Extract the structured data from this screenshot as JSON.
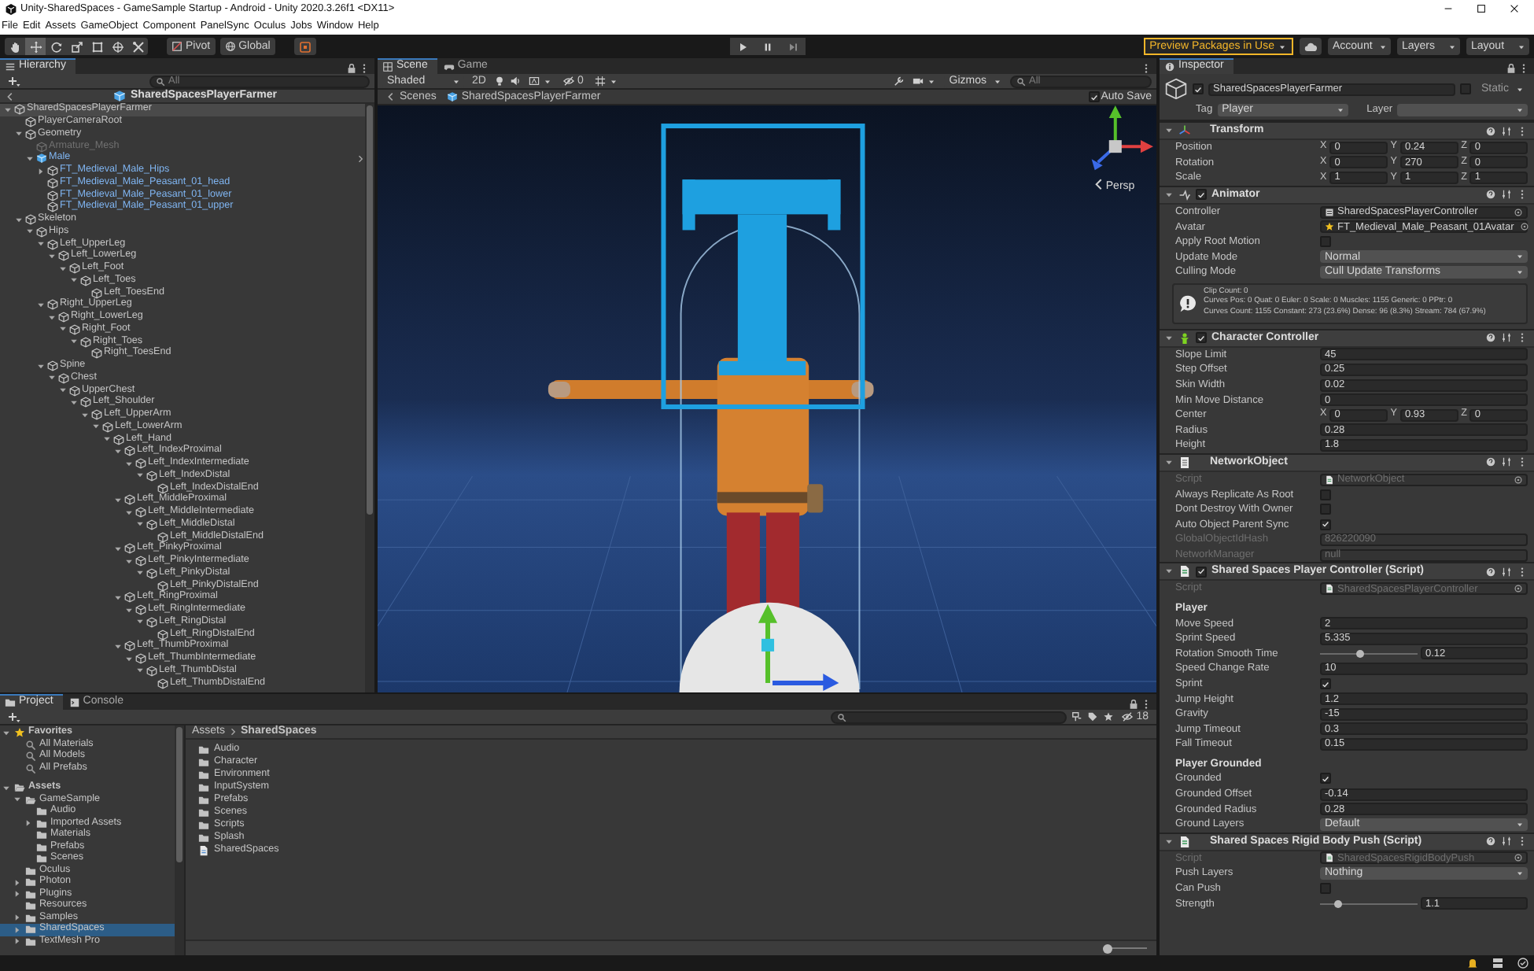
{
  "window": {
    "title": "Unity-SharedSpaces - GameSample Startup - Android - Unity 2020.3.26f1 <DX11>"
  },
  "menu": [
    "File",
    "Edit",
    "Assets",
    "GameObject",
    "Component",
    "PanelSync",
    "Oculus",
    "Jobs",
    "Window",
    "Help"
  ],
  "toolbar": {
    "tools": [
      {
        "kind": "hand",
        "selected": false
      },
      {
        "kind": "move",
        "selected": true
      },
      {
        "kind": "rotate",
        "selected": false
      },
      {
        "kind": "scale",
        "selected": false
      },
      {
        "kind": "rect",
        "selected": false
      },
      {
        "kind": "transform",
        "selected": false
      },
      {
        "kind": "custom",
        "selected": false
      }
    ],
    "pivot": "Pivot",
    "space": "Global",
    "preview_packages": "Preview Packages in Use",
    "account": "Account",
    "layers": "Layers",
    "layout": "Layout"
  },
  "hierarchy": {
    "tab": "Hierarchy",
    "search": {
      "placeholder": "All"
    },
    "prefab_stage": "SharedSpacesPlayerFarmer",
    "items": [
      {
        "name": "SharedSpacesPlayerFarmer",
        "kind": "object",
        "selected": true,
        "expanded": true,
        "children": [
          {
            "name": "PlayerCameraRoot",
            "kind": "object",
            "selected": false
          },
          {
            "name": "Geometry",
            "kind": "object",
            "selected": false,
            "expanded": true,
            "children": [
              {
                "name": "Armature_Mesh",
                "kind": "inactive",
                "selected": false
              },
              {
                "name": "Male",
                "kind": "prefab",
                "selected": false,
                "expanded": true,
                "children": [
                  {
                    "name": "FT_Medieval_Male_Hips",
                    "kind": "prefab_child",
                    "selected": false,
                    "expanded": false
                  },
                  {
                    "name": "FT_Medieval_Male_Peasant_01_head",
                    "kind": "prefab_child",
                    "selected": false
                  },
                  {
                    "name": "FT_Medieval_Male_Peasant_01_lower",
                    "kind": "prefab_child",
                    "selected": false
                  },
                  {
                    "name": "FT_Medieval_Male_Peasant_01_upper",
                    "kind": "prefab_child",
                    "selected": false
                  }
                ]
              }
            ]
          },
          {
            "name": "Skeleton",
            "kind": "object",
            "selected": false,
            "expanded": true,
            "children": [
              {
                "name": "Hips",
                "kind": "object",
                "selected": false,
                "expanded": true,
                "children": [
                  {
                    "name": "Left_UpperLeg",
                    "kind": "object",
                    "selected": false,
                    "expanded": true,
                    "children": [
                      {
                        "name": "Left_LowerLeg",
                        "kind": "object",
                        "selected": false,
                        "expanded": true,
                        "children": [
                          {
                            "name": "Left_Foot",
                            "kind": "object",
                            "selected": false,
                            "expanded": true,
                            "children": [
                              {
                                "name": "Left_Toes",
                                "kind": "object",
                                "selected": false,
                                "expanded": true,
                                "children": [
                                  {
                                    "name": "Left_ToesEnd",
                                    "kind": "object",
                                    "selected": false
                                  }
                                ]
                              }
                            ]
                          }
                        ]
                      }
                    ]
                  },
                  {
                    "name": "Right_UpperLeg",
                    "kind": "object",
                    "selected": false,
                    "expanded": true,
                    "children": [
                      {
                        "name": "Right_LowerLeg",
                        "kind": "object",
                        "selected": false,
                        "expanded": true,
                        "children": [
                          {
                            "name": "Right_Foot",
                            "kind": "object",
                            "selected": false,
                            "expanded": true,
                            "children": [
                              {
                                "name": "Right_Toes",
                                "kind": "object",
                                "selected": false,
                                "expanded": true,
                                "children": [
                                  {
                                    "name": "Right_ToesEnd",
                                    "kind": "object",
                                    "selected": false
                                  }
                                ]
                              }
                            ]
                          }
                        ]
                      }
                    ]
                  },
                  {
                    "name": "Spine",
                    "kind": "object",
                    "selected": false,
                    "expanded": true,
                    "children": [
                      {
                        "name": "Chest",
                        "kind": "object",
                        "selected": false,
                        "expanded": true,
                        "children": [
                          {
                            "name": "UpperChest",
                            "kind": "object",
                            "selected": false,
                            "expanded": true,
                            "children": [
                              {
                                "name": "Left_Shoulder",
                                "kind": "object",
                                "selected": false,
                                "expanded": true,
                                "children": [
                                  {
                                    "name": "Left_UpperArm",
                                    "kind": "object",
                                    "selected": false,
                                    "expanded": true,
                                    "children": [
                                      {
                                        "name": "Left_LowerArm",
                                        "kind": "object",
                                        "selected": false,
                                        "expanded": true,
                                        "children": [
                                          {
                                            "name": "Left_Hand",
                                            "kind": "object",
                                            "selected": false,
                                            "expanded": true,
                                            "children": [
                                              {
                                                "name": "Left_IndexProximal",
                                                "kind": "object",
                                                "selected": false,
                                                "expanded": true,
                                                "children": [
                                                  {
                                                    "name": "Left_IndexIntermediate",
                                                    "kind": "object",
                                                    "selected": false,
                                                    "expanded": true,
                                                    "children": [
                                                      {
                                                        "name": "Left_IndexDistal",
                                                        "kind": "object",
                                                        "selected": false,
                                                        "expanded": true,
                                                        "children": [
                                                          {
                                                            "name": "Left_IndexDistalEnd",
                                                            "kind": "object",
                                                            "selected": false
                                                          }
                                                        ]
                                                      }
                                                    ]
                                                  }
                                                ]
                                              },
                                              {
                                                "name": "Left_MiddleProximal",
                                                "kind": "object",
                                                "selected": false,
                                                "expanded": true,
                                                "children": [
                                                  {
                                                    "name": "Left_MiddleIntermediate",
                                                    "kind": "object",
                                                    "selected": false,
                                                    "expanded": true,
                                                    "children": [
                                                      {
                                                        "name": "Left_MiddleDistal",
                                                        "kind": "object",
                                                        "selected": false,
                                                        "expanded": true,
                                                        "children": [
                                                          {
                                                            "name": "Left_MiddleDistalEnd",
                                                            "kind": "object",
                                                            "selected": false
                                                          }
                                                        ]
                                                      }
                                                    ]
                                                  }
                                                ]
                                              },
                                              {
                                                "name": "Left_PinkyProximal",
                                                "kind": "object",
                                                "selected": false,
                                                "expanded": true,
                                                "children": [
                                                  {
                                                    "name": "Left_PinkyIntermediate",
                                                    "kind": "object",
                                                    "selected": false,
                                                    "expanded": true,
                                                    "children": [
                                                      {
                                                        "name": "Left_PinkyDistal",
                                                        "kind": "object",
                                                        "selected": false,
                                                        "expanded": true,
                                                        "children": [
                                                          {
                                                            "name": "Left_PinkyDistalEnd",
                                                            "kind": "object",
                                                            "selected": false
                                                          }
                                                        ]
                                                      }
                                                    ]
                                                  }
                                                ]
                                              },
                                              {
                                                "name": "Left_RingProximal",
                                                "kind": "object",
                                                "selected": false,
                                                "expanded": true,
                                                "children": [
                                                  {
                                                    "name": "Left_RingIntermediate",
                                                    "kind": "object",
                                                    "selected": false,
                                                    "expanded": true,
                                                    "children": [
                                                      {
                                                        "name": "Left_RingDistal",
                                                        "kind": "object",
                                                        "selected": false,
                                                        "expanded": true,
                                                        "children": [
                                                          {
                                                            "name": "Left_RingDistalEnd",
                                                            "kind": "object",
                                                            "selected": false
                                                          }
                                                        ]
                                                      }
                                                    ]
                                                  }
                                                ]
                                              },
                                              {
                                                "name": "Left_ThumbProximal",
                                                "kind": "object",
                                                "selected": false,
                                                "expanded": true,
                                                "children": [
                                                  {
                                                    "name": "Left_ThumbIntermediate",
                                                    "kind": "object",
                                                    "selected": false,
                                                    "expanded": true,
                                                    "children": [
                                                      {
                                                        "name": "Left_ThumbDistal",
                                                        "kind": "object",
                                                        "selected": false,
                                                        "expanded": true,
                                                        "children": [
                                                          {
                                                            "name": "Left_ThumbDistalEnd",
                                                            "kind": "object",
                                                            "selected": false
                                                          }
                                                        ]
                                                      }
                                                    ]
                                                  }
                                                ]
                                              }
                                            ]
                                          }
                                        ]
                                      }
                                    ]
                                  }
                                ]
                              }
                            ]
                          }
                        ]
                      }
                    ]
                  }
                ]
              }
            ]
          }
        ]
      }
    ]
  },
  "scene": {
    "tabs": [
      {
        "label": "Scene",
        "kind": "scene",
        "selected": true
      },
      {
        "label": "Game",
        "kind": "game",
        "selected": false
      }
    ],
    "shading": "Shaded",
    "mode_2d": "2D",
    "hidden_count": "0",
    "gizmos": "Gizmos",
    "search": {
      "placeholder": "All"
    },
    "breadcrumb": [
      "Scenes",
      "SharedSpacesPlayerFarmer"
    ],
    "auto_save": {
      "label": "Auto Save",
      "checked": true
    },
    "view_label": "Persp"
  },
  "inspector": {
    "tab": "Inspector",
    "object": {
      "active": true,
      "name": "SharedSpacesPlayerFarmer",
      "static": false,
      "static_label": "Static",
      "tag_label": "Tag",
      "tag": "Player",
      "layer_label": "Layer"
    },
    "components": [
      {
        "title": "Transform",
        "kind": "transform",
        "rows": [
          {
            "label": "Position",
            "kind": "vector",
            "values": [
              {
                "axis": "X",
                "value": "0"
              },
              {
                "axis": "Y",
                "value": "0.24"
              },
              {
                "axis": "Z",
                "value": "0"
              }
            ]
          },
          {
            "label": "Rotation",
            "kind": "vector",
            "values": [
              {
                "axis": "X",
                "value": "0"
              },
              {
                "axis": "Y",
                "value": "270"
              },
              {
                "axis": "Z",
                "value": "0"
              }
            ]
          },
          {
            "label": "Scale",
            "kind": "vector",
            "values": [
              {
                "axis": "X",
                "value": "1"
              },
              {
                "axis": "Y",
                "value": "1"
              },
              {
                "axis": "Z",
                "value": "1"
              }
            ]
          }
        ]
      },
      {
        "title": "Animator",
        "kind": "animator",
        "enabled": true,
        "rows": [
          {
            "label": "Controller",
            "kind": "object",
            "value": "SharedSpacesPlayerController"
          },
          {
            "label": "Avatar",
            "kind": "object",
            "value": "FT_Medieval_Male_Peasant_01Avatar"
          },
          {
            "label": "Apply Root Motion",
            "kind": "toggle",
            "checked": false
          },
          {
            "label": "Update Mode",
            "kind": "dropdown",
            "value": "Normal"
          },
          {
            "label": "Culling Mode",
            "kind": "dropdown",
            "value": "Cull Update Transforms"
          },
          {
            "kind": "info",
            "lines": [
              "Clip Count: 0",
              "Curves Pos: 0 Quat: 0 Euler: 0 Scale: 0 Muscles: 1155 Generic: 0 PPtr: 0",
              "Curves Count: 1155 Constant: 273 (23.6%) Dense: 96 (8.3%) Stream: 784 (67.9%)"
            ]
          }
        ]
      },
      {
        "title": "Character Controller",
        "kind": "character",
        "enabled": true,
        "rows": [
          {
            "label": "Slope Limit",
            "kind": "field",
            "value": "45"
          },
          {
            "label": "Step Offset",
            "kind": "field",
            "value": "0.25"
          },
          {
            "label": "Skin Width",
            "kind": "field",
            "value": "0.02"
          },
          {
            "label": "Min Move Distance",
            "kind": "field",
            "value": "0"
          },
          {
            "label": "Center",
            "kind": "vector",
            "values": [
              {
                "axis": "X",
                "value": "0"
              },
              {
                "axis": "Y",
                "value": "0.93"
              },
              {
                "axis": "Z",
                "value": "0"
              }
            ]
          },
          {
            "label": "Radius",
            "kind": "field",
            "value": "0.28"
          },
          {
            "label": "Height",
            "kind": "field",
            "value": "1.8"
          }
        ]
      },
      {
        "title": "NetworkObject",
        "kind": "network",
        "rows": [
          {
            "label": "Script",
            "kind": "script",
            "value": "NetworkObject"
          },
          {
            "label": "Always Replicate As Root",
            "kind": "toggle",
            "checked": false
          },
          {
            "label": "Dont Destroy With Owner",
            "kind": "toggle",
            "checked": false
          },
          {
            "label": "Auto Object Parent Sync",
            "kind": "toggle",
            "checked": true
          },
          {
            "label": "GlobalObjectIdHash",
            "kind": "readonly",
            "value": "826220090"
          },
          {
            "label": "NetworkManager",
            "kind": "readonly",
            "value": "null"
          }
        ]
      },
      {
        "title": "Shared Spaces Player Controller (Script)",
        "kind": "script",
        "enabled": true,
        "rows": [
          {
            "label": "Script",
            "kind": "script",
            "value": "SharedSpacesPlayerController"
          },
          {
            "label": "Player",
            "kind": "header"
          },
          {
            "label": "Move Speed",
            "kind": "field",
            "value": "2"
          },
          {
            "label": "Sprint Speed",
            "kind": "field",
            "value": "5.335"
          },
          {
            "label": "Rotation Smooth Time",
            "kind": "slider",
            "level": 0.41,
            "reading": "0.12"
          },
          {
            "label": "Speed Change Rate",
            "kind": "field",
            "value": "10"
          },
          {
            "label": "Sprint",
            "kind": "toggle",
            "checked": true
          },
          {
            "label": "Jump Height",
            "kind": "field",
            "value": "1.2"
          },
          {
            "label": "Gravity",
            "kind": "field",
            "value": "-15"
          },
          {
            "label": "Jump Timeout",
            "kind": "field",
            "value": "0.3"
          },
          {
            "label": "Fall Timeout",
            "kind": "field",
            "value": "0.15"
          },
          {
            "label": "Player Grounded",
            "kind": "header"
          },
          {
            "label": "Grounded",
            "kind": "toggle",
            "checked": true
          },
          {
            "label": "Grounded Offset",
            "kind": "field",
            "value": "-0.14"
          },
          {
            "label": "Grounded Radius",
            "kind": "field",
            "value": "0.28"
          },
          {
            "label": "Ground Layers",
            "kind": "dropdown",
            "value": "Default"
          }
        ]
      },
      {
        "title": "Shared Spaces Rigid Body Push (Script)",
        "kind": "script",
        "rows": [
          {
            "label": "Script",
            "kind": "script",
            "value": "SharedSpacesRigidBodyPush"
          },
          {
            "label": "Push Layers",
            "kind": "dropdown",
            "value": "Nothing"
          },
          {
            "label": "Can Push",
            "kind": "toggle",
            "checked": false
          },
          {
            "label": "Strength",
            "kind": "slider",
            "level": 0.15,
            "reading": "1.1"
          }
        ]
      }
    ]
  },
  "project": {
    "tabs": [
      {
        "label": "Project",
        "kind": "project",
        "selected": true
      },
      {
        "label": "Console",
        "kind": "console",
        "selected": false
      }
    ],
    "visible_count": "18",
    "tree": [
      {
        "name": "Favorites",
        "kind": "favorites",
        "selected": false,
        "expanded": true,
        "children": [
          {
            "name": "All Materials",
            "kind": "search",
            "selected": false
          },
          {
            "name": "All Models",
            "kind": "search",
            "selected": false
          },
          {
            "name": "All Prefabs",
            "kind": "search",
            "selected": false
          }
        ]
      },
      {
        "name": "Assets",
        "kind": "root",
        "selected": false,
        "expanded": true,
        "children": [
          {
            "name": "GameSample",
            "kind": "folder",
            "selected": false,
            "expanded": true,
            "children": [
              {
                "name": "Audio",
                "kind": "folder",
                "selected": false
              },
              {
                "name": "Imported Assets",
                "kind": "folder",
                "selected": false,
                "expanded": false
              },
              {
                "name": "Materials",
                "kind": "folder",
                "selected": false
              },
              {
                "name": "Prefabs",
                "kind": "folder",
                "selected": false
              },
              {
                "name": "Scenes",
                "kind": "folder",
                "selected": false
              }
            ]
          },
          {
            "name": "Oculus",
            "kind": "folder",
            "selected": false
          },
          {
            "name": "Photon",
            "kind": "folder",
            "selected": false,
            "expanded": false
          },
          {
            "name": "Plugins",
            "kind": "folder",
            "selected": false,
            "expanded": false
          },
          {
            "name": "Resources",
            "kind": "folder",
            "selected": false
          },
          {
            "name": "Samples",
            "kind": "folder",
            "selected": false,
            "expanded": false
          },
          {
            "name": "SharedSpaces",
            "kind": "folder",
            "selected": true,
            "expanded": false
          },
          {
            "name": "TextMesh Pro",
            "kind": "folder",
            "selected": false,
            "expanded": false
          }
        ]
      }
    ],
    "breadcrumb": [
      "Assets",
      "SharedSpaces"
    ],
    "files": [
      {
        "name": "Audio",
        "kind": "folder"
      },
      {
        "name": "Character",
        "kind": "folder"
      },
      {
        "name": "Environment",
        "kind": "folder"
      },
      {
        "name": "InputSystem",
        "kind": "folder"
      },
      {
        "name": "Prefabs",
        "kind": "folder"
      },
      {
        "name": "Scenes",
        "kind": "folder"
      },
      {
        "name": "Scripts",
        "kind": "folder"
      },
      {
        "name": "Splash",
        "kind": "folder"
      },
      {
        "name": "SharedSpaces",
        "kind": "asset"
      }
    ],
    "icon_size": {
      "level": 0
    }
  }
}
